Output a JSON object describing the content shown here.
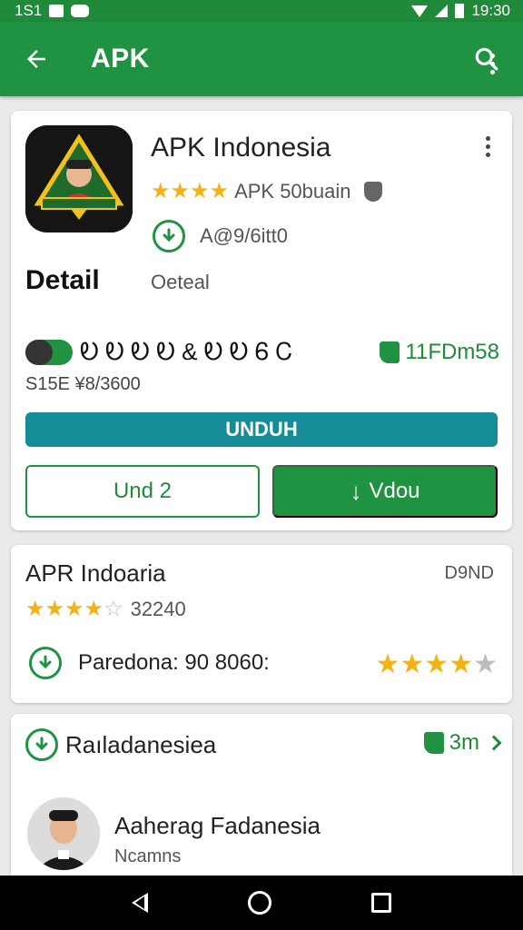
{
  "status_bar": {
    "time_left": "1S1",
    "time_right": "19:30"
  },
  "app_bar": {
    "title": "APK",
    "icons": [
      "back-arrow-icon",
      "search-icon",
      "more-vert-icon"
    ]
  },
  "app_card": {
    "name": "APK Indonesia",
    "stars": "★★★★",
    "rating_text": "APK 50buain",
    "downloads_text": "A@9/6itt0",
    "detail_heading": "Detail",
    "detail_sub": "Oeteal",
    "stat_left": "Ꭷ Ꭷ Ꭷ Ꭷ & Ꭷ Ꭷ Ꮾ Ꮯ",
    "stat_right": "11FDm58",
    "size_line": "S15E ¥8/3600",
    "btn_primary": "UNDUH",
    "btn_outline": "Und 2",
    "btn_solid_glyph": "↓",
    "btn_solid": "Vdou"
  },
  "card2": {
    "title": "APR Indoaria",
    "badge": "D9ND",
    "stars_filled": "★★★★",
    "stars_empty": "☆",
    "rating_count": "32240",
    "row_text": "Paredona: 90 8060:",
    "row_stars_filled": "★★★★",
    "row_stars_empty": "★"
  },
  "card3": {
    "title": "Raıladanesiea",
    "right_value": "3m",
    "person_name": "Aaherag Fadanesia",
    "person_sub": "Ncamns"
  },
  "colors": {
    "primary_green": "#1f9342",
    "status_green": "#1f8a3a",
    "teal_button": "#158c96",
    "star_yellow": "#f2b21a"
  }
}
